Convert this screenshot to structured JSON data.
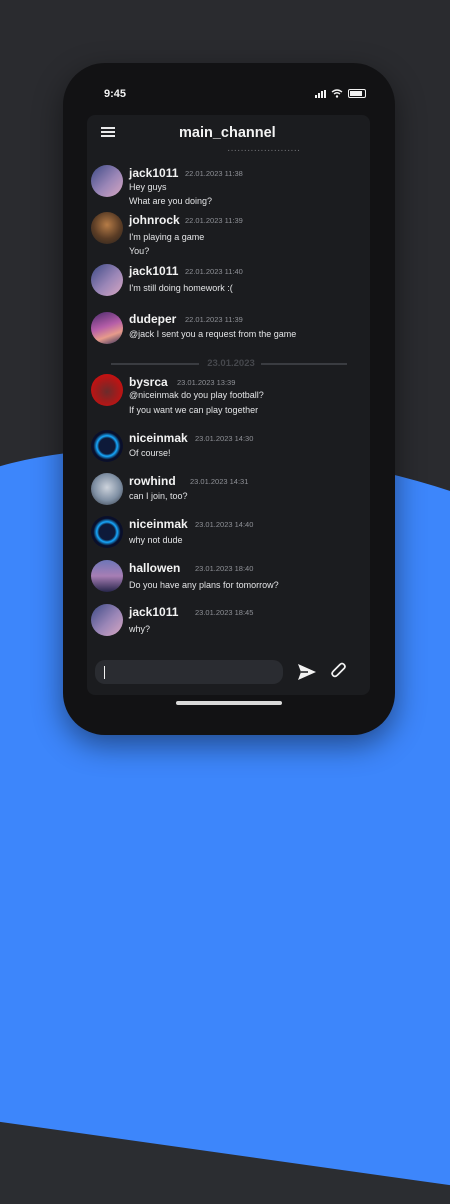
{
  "status": {
    "time": "9:45"
  },
  "header": {
    "title": "main_channel"
  },
  "composer": {
    "placeholder": ""
  },
  "date_divider": "23.01.2023",
  "messages": [
    {
      "user": "jack1011",
      "time": "22.01.2023 11:38",
      "lines": [
        "Hey guys",
        "What are you doing?"
      ]
    },
    {
      "user": "johnrock",
      "time": "22.01.2023 11:39",
      "lines": [
        "I'm playing a game",
        "You?"
      ]
    },
    {
      "user": "jack1011",
      "time": "22.01.2023 11:40",
      "lines": [
        "I'm still doing homework :("
      ]
    },
    {
      "user": "dudeper",
      "time": "22.01.2023 11:39",
      "lines": [
        "@jack I sent you a request from the game"
      ]
    },
    {
      "user": "bysrca",
      "time": "23.01.2023 13:39",
      "lines": [
        "@niceinmak do you play football?",
        "If you want we can play together"
      ]
    },
    {
      "user": "niceinmak",
      "time": "23.01.2023 14:30",
      "lines": [
        "Of course!"
      ]
    },
    {
      "user": "rowhind",
      "time": "23.01.2023 14:31",
      "lines": [
        "can I join, too?"
      ]
    },
    {
      "user": "niceinmak",
      "time": "23.01.2023 14:40",
      "lines": [
        "why not dude"
      ]
    },
    {
      "user": "hallowen",
      "time": "23.01.2023 18:40",
      "lines": [
        "Do you have any plans for tomorrow?"
      ]
    },
    {
      "user": "jack1011",
      "time": "23.01.2023 18:45",
      "lines": [
        "why?"
      ]
    }
  ],
  "icons": {
    "menu": "hamburger-menu-icon",
    "send": "send-icon",
    "attach": "paperclip-icon"
  }
}
